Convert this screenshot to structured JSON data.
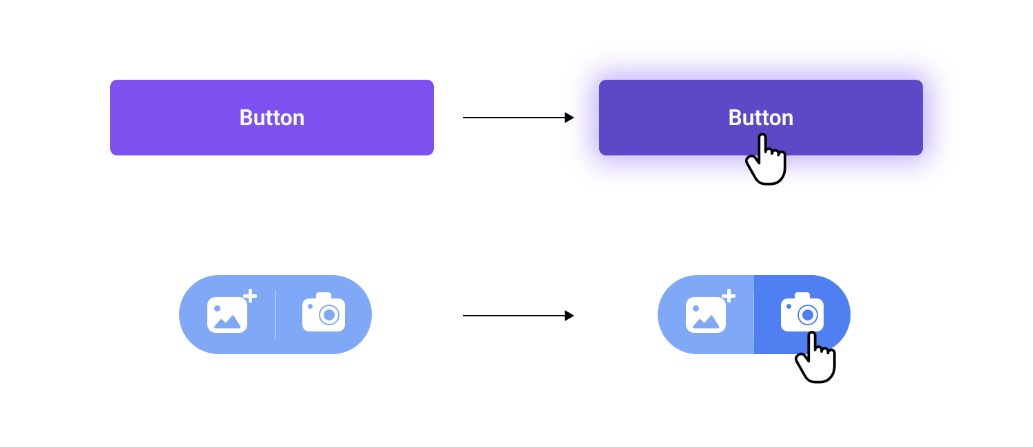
{
  "row1": {
    "default": {
      "label": "Button",
      "bg": "#7c51f0"
    },
    "hover": {
      "label": "Button",
      "bg": "#5d49c8",
      "glow": "rgba(124,81,240,.45)"
    }
  },
  "row2": {
    "left_icon": "image-add-icon",
    "right_icon": "camera-icon",
    "default_bg": "#7fa8f7",
    "hover_right_bg": "#4f7ff0"
  },
  "cursor": "pointer-hand"
}
